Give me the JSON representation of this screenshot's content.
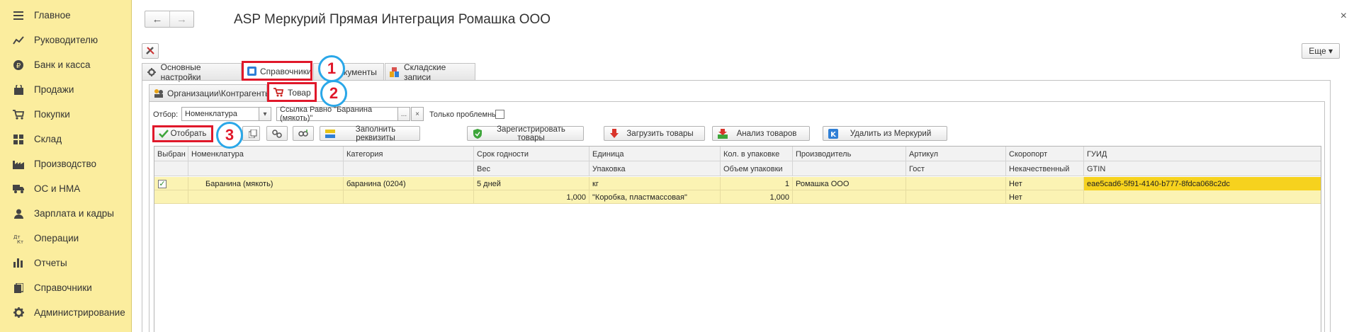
{
  "sidebar": {
    "items": [
      {
        "label": "Главное",
        "icon": "menu-icon"
      },
      {
        "label": "Руководителю",
        "icon": "chart-line-icon"
      },
      {
        "label": "Банк и касса",
        "icon": "ruble-coin-icon"
      },
      {
        "label": "Продажи",
        "icon": "shopping-bag-icon"
      },
      {
        "label": "Покупки",
        "icon": "cart-icon"
      },
      {
        "label": "Склад",
        "icon": "grid-icon"
      },
      {
        "label": "Производство",
        "icon": "factory-icon"
      },
      {
        "label": "ОС и НМА",
        "icon": "truck-icon"
      },
      {
        "label": "Зарплата и кадры",
        "icon": "person-icon"
      },
      {
        "label": "Операции",
        "icon": "debit-credit-icon"
      },
      {
        "label": "Отчеты",
        "icon": "bar-chart-icon"
      },
      {
        "label": "Справочники",
        "icon": "book-icon"
      },
      {
        "label": "Администрирование",
        "icon": "gear-icon"
      }
    ]
  },
  "window": {
    "title": "ASP Меркурий Прямая Интеграция Ромашка ООО",
    "more_label": "Еще ▾",
    "back_glyph": "←",
    "forward_glyph": "→",
    "close_glyph": "×"
  },
  "tabs": {
    "main": [
      "Основные настройки",
      "Справочники",
      "Документы",
      "Складские записи"
    ],
    "sub": [
      "Организации\\Контрагенты",
      "Товар"
    ]
  },
  "annotations": [
    "1",
    "2",
    "3"
  ],
  "filter": {
    "label": "Отбор:",
    "field_value": "Номенклатура",
    "condition_value": "Ссылка Равно \"Баранина (мякоть)\"",
    "ellipsis": "...",
    "clear": "×",
    "problem_label": "Только проблемные:"
  },
  "toolbar": {
    "select": "Отобрать",
    "fill": "Заполнить реквизиты",
    "register": "Зарегистрировать товары",
    "load": "Загрузить товары",
    "analyze": "Анализ товаров",
    "delete": "Удалить из Меркурий"
  },
  "table": {
    "headers_row1": [
      "Выбран",
      "Номенклатура",
      "Категория",
      "Срок годности",
      "Единица",
      "Кол. в упаковке",
      "Производитель",
      "Артикул",
      "Скоропорт",
      "ГУИД"
    ],
    "headers_row2": [
      "Вес",
      "Упаковка",
      "Объем упаковки",
      "Гост",
      "Некачественный",
      "GTIN"
    ],
    "row1": {
      "check": "✓",
      "name": "Баранина (мякоть)",
      "category": "баранина (0204)",
      "shelf": "5 дней",
      "unit": "кг",
      "qty": "1",
      "producer": "Ромашка ООО",
      "article": "",
      "perishable": "Нет",
      "guid": "eae5cad6-5f91-4140-b777-8fdca068c2dc"
    },
    "row2": {
      "weight": "1,000",
      "package": "\"Коробка, пластмассовая\"",
      "volume": "1,000",
      "defective": "Нет"
    }
  }
}
